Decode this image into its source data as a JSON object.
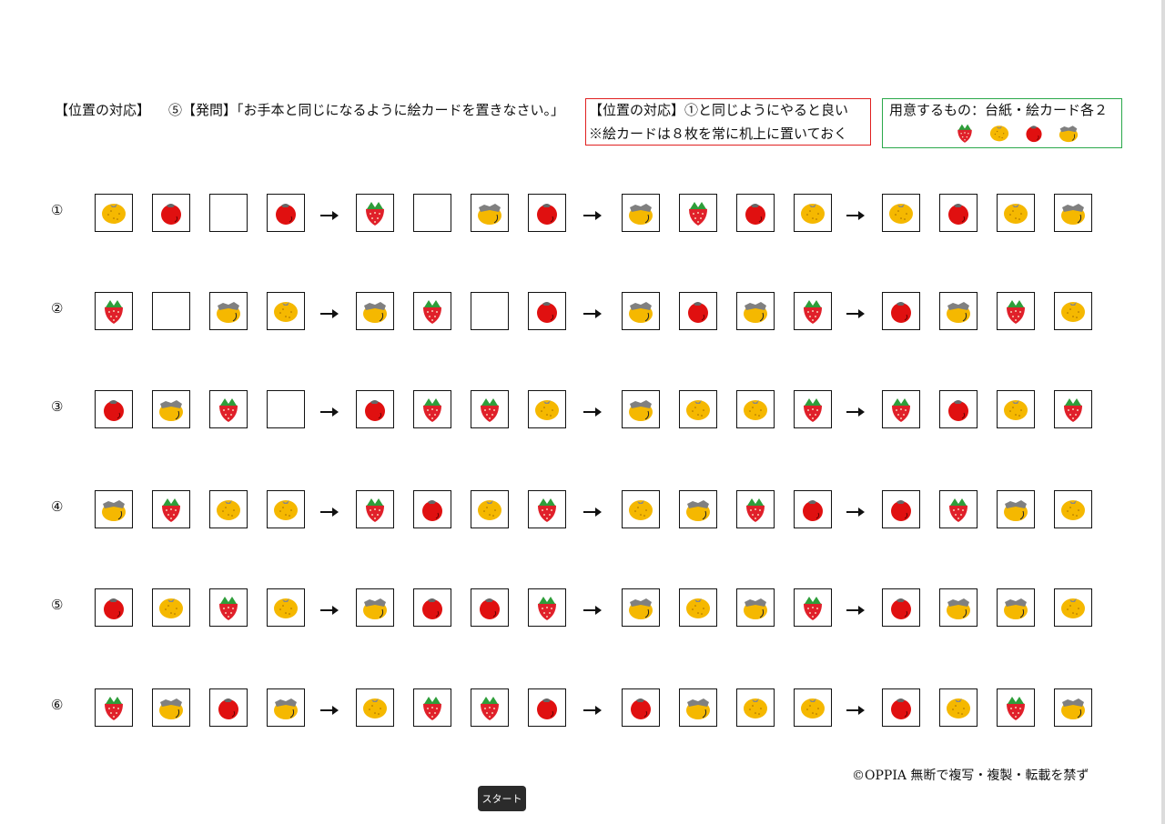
{
  "header": {
    "left_title": "【位置の対応】",
    "question": "⑤【発問】「お手本と同じになるように絵カードを置きなさい。」",
    "red_box_line1": "【位置の対応】①と同じようにやると良い",
    "red_box_line2": "※絵カードは８枚を常に机上に置いておく",
    "green_box_line1": "用意するもの：台紙・絵カード各２",
    "green_box_icons": [
      "strawberry-icon",
      "orange-icon",
      "apple-icon",
      "persimmon-icon"
    ]
  },
  "rows": [
    {
      "label": "①",
      "cards": [
        "orange",
        "apple",
        "empty",
        "apple",
        "strawberry",
        "empty",
        "persimmon",
        "apple",
        "persimmon",
        "strawberry",
        "apple",
        "orange",
        "orange",
        "apple",
        "orange",
        "persimmon"
      ]
    },
    {
      "label": "②",
      "cards": [
        "strawberry",
        "empty",
        "persimmon",
        "orange",
        "persimmon",
        "strawberry",
        "empty",
        "apple",
        "persimmon",
        "apple",
        "persimmon",
        "strawberry",
        "apple",
        "persimmon",
        "strawberry",
        "orange"
      ]
    },
    {
      "label": "③",
      "cards": [
        "apple",
        "persimmon",
        "strawberry",
        "empty",
        "apple",
        "strawberry",
        "strawberry",
        "orange",
        "persimmon",
        "orange",
        "orange",
        "strawberry",
        "strawberry",
        "apple",
        "orange",
        "strawberry"
      ]
    },
    {
      "label": "④",
      "cards": [
        "persimmon",
        "strawberry",
        "orange",
        "orange",
        "strawberry",
        "apple",
        "orange",
        "strawberry",
        "orange",
        "persimmon",
        "strawberry",
        "apple",
        "apple",
        "strawberry",
        "persimmon",
        "orange"
      ]
    },
    {
      "label": "⑤",
      "cards": [
        "apple",
        "orange",
        "strawberry",
        "orange",
        "persimmon",
        "apple",
        "apple",
        "strawberry",
        "persimmon",
        "orange",
        "persimmon",
        "strawberry",
        "apple",
        "persimmon",
        "persimmon",
        "orange"
      ]
    },
    {
      "label": "⑥",
      "cards": [
        "strawberry",
        "persimmon",
        "apple",
        "persimmon",
        "orange",
        "strawberry",
        "strawberry",
        "apple",
        "apple",
        "persimmon",
        "orange",
        "orange",
        "apple",
        "orange",
        "strawberry",
        "persimmon"
      ]
    }
  ],
  "footer": {
    "copyright": "©OPPIA 無断で複写・複製・転載を禁ず"
  },
  "taskbar": {
    "start_label": "スタート"
  },
  "colors": {
    "red_box": "#e02020",
    "green_box": "#2aa84a",
    "apple": "#e01010",
    "orange": "#f5b800",
    "strawberry_red": "#e0202a",
    "leaf_green": "#2e9e3a",
    "persimmon_cap": "#808080"
  }
}
